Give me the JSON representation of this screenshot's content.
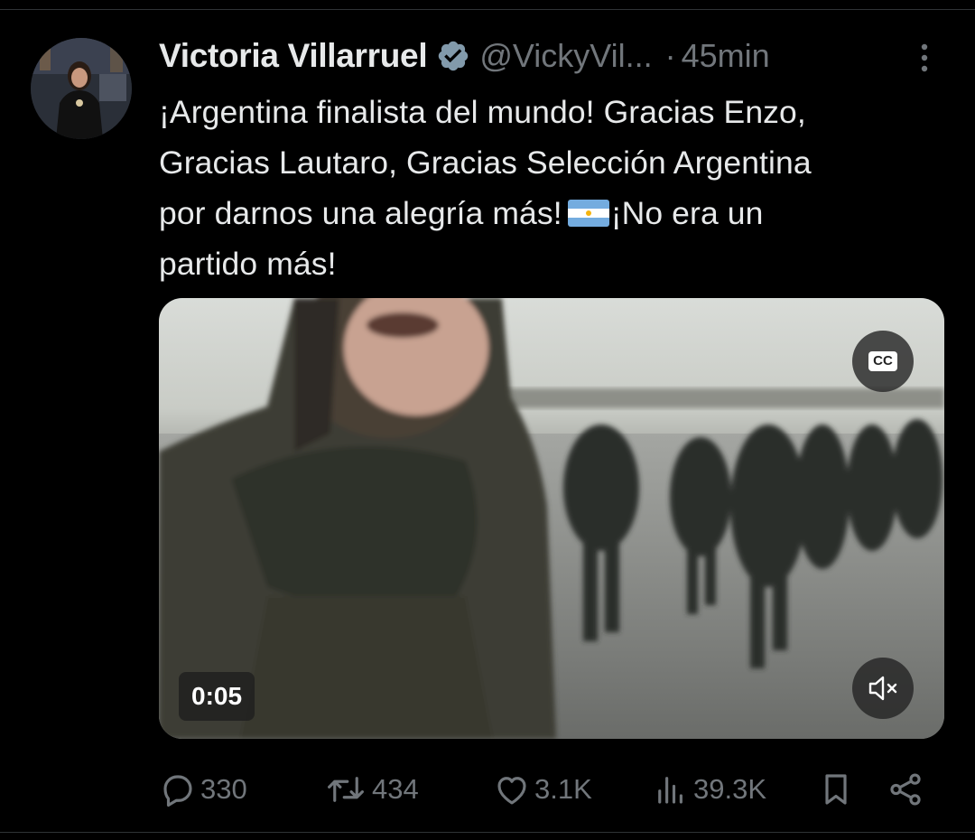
{
  "tweet": {
    "author_name": "Victoria Villarruel",
    "handle": "@VickyVil...",
    "separator": "·",
    "time": "45min",
    "text_lines": [
      "¡Argentina finalista del mundo! Gracias Enzo,",
      "Gracias Lautaro, Gracias Selección Argentina",
      "por darnos una alegría más!",
      "¡No era un",
      "partido más!"
    ],
    "flag_icon": "argentina-flag-emoji"
  },
  "media": {
    "duration": "0:05",
    "cc_label": "CC",
    "mute_icon": "speaker-muted-icon"
  },
  "actions": {
    "replies": "330",
    "reposts": "434",
    "likes": "3.1K",
    "views": "39.3K"
  },
  "colors": {
    "background": "#000000",
    "text_primary": "#e7e9ea",
    "text_secondary": "#71767b",
    "verified_badge": "#829aab",
    "divider": "#2f3336"
  }
}
